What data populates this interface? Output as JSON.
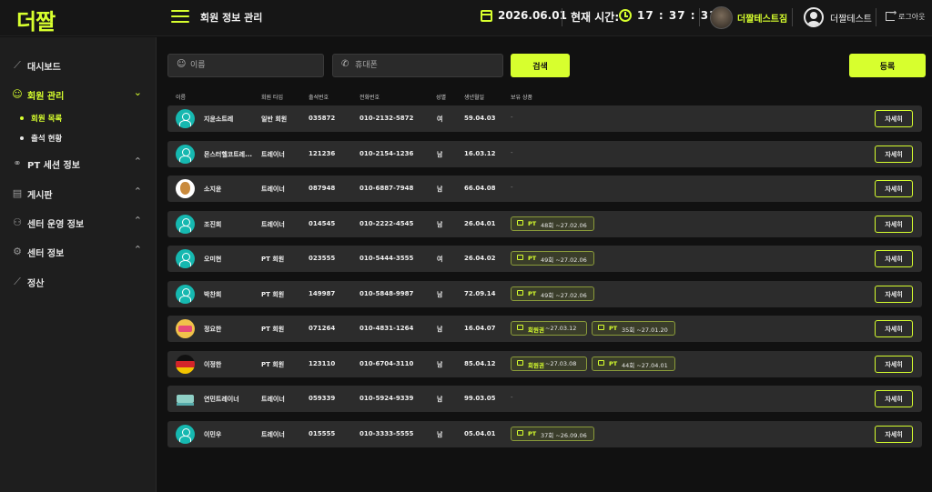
{
  "brand": {
    "logo_text": "더짤",
    "accent": "#d7ff2e"
  },
  "header": {
    "page_title": "회원 정보 관리",
    "date": "2026.06.01",
    "time_label": "현재 시간:",
    "time": "17 : 37 : 31",
    "gym_name": "더짤테스트짐",
    "user_name": "더짤테스트",
    "logout_label": "로그아웃"
  },
  "sidebar": {
    "items": [
      {
        "label": "대시보드",
        "icon": "chart-icon",
        "expandable": false
      },
      {
        "label": "회원 관리",
        "icon": "user-icon",
        "expandable": true,
        "expanded": true,
        "active": true
      },
      {
        "label": "PT 세션 정보",
        "icon": "link-icon",
        "expandable": true
      },
      {
        "label": "게시판",
        "icon": "document-icon",
        "expandable": true
      },
      {
        "label": "센터 운영 정보",
        "icon": "people-icon",
        "expandable": true
      },
      {
        "label": "센터 정보",
        "icon": "gear-icon",
        "expandable": true
      },
      {
        "label": "정산",
        "icon": "chart-icon",
        "expandable": false
      }
    ],
    "sub_items": [
      {
        "label": "회원 목록",
        "active": true
      },
      {
        "label": "출석 현황",
        "active": false
      }
    ]
  },
  "search": {
    "name_placeholder": "이름",
    "phone_placeholder": "휴대폰",
    "search_button": "검색",
    "register_button": "등록"
  },
  "table": {
    "columns": [
      "이름",
      "회원 타입",
      "출석번호",
      "전화번호",
      "성별",
      "생년월일",
      "보유 상품"
    ],
    "detail_label": "자세히",
    "rows": [
      {
        "avatar": "default",
        "name": "지윤소트레",
        "type": "일반 회원",
        "attend": "035872",
        "phone": "010-2132-5872",
        "gender": "여",
        "birth": "59.04.03",
        "products": []
      },
      {
        "avatar": "default",
        "name": "몬스터헬코트레...",
        "type": "트레이너",
        "attend": "121236",
        "phone": "010-2154-1236",
        "gender": "남",
        "birth": "16.03.12",
        "products": []
      },
      {
        "avatar": "dog",
        "name": "소지윤",
        "type": "트레이너",
        "attend": "087948",
        "phone": "010-6887-7948",
        "gender": "남",
        "birth": "66.04.08",
        "products": []
      },
      {
        "avatar": "default",
        "name": "조진희",
        "type": "트레이너",
        "attend": "014545",
        "phone": "010-2222-4545",
        "gender": "남",
        "birth": "26.04.01",
        "products": [
          {
            "name": "PT",
            "detail": "48회 ~27.02.06"
          }
        ]
      },
      {
        "avatar": "default",
        "name": "오미현",
        "type": "PT 회원",
        "attend": "023555",
        "phone": "010-5444-3555",
        "gender": "여",
        "birth": "26.04.02",
        "products": [
          {
            "name": "PT",
            "detail": "49회 ~27.02.06"
          }
        ]
      },
      {
        "avatar": "default",
        "name": "박찬희",
        "type": "PT 회원",
        "attend": "149987",
        "phone": "010-5848-9987",
        "gender": "남",
        "birth": "72.09.14",
        "products": [
          {
            "name": "PT",
            "detail": "49회 ~27.02.06"
          }
        ]
      },
      {
        "avatar": "badge",
        "name": "정요한",
        "type": "PT 회원",
        "attend": "071264",
        "phone": "010-4831-1264",
        "gender": "남",
        "birth": "16.04.07",
        "products": [
          {
            "name": "회원권",
            "detail": "~27.03.12"
          },
          {
            "name": "PT",
            "detail": "35회 ~27.01.20"
          }
        ]
      },
      {
        "avatar": "germany",
        "name": "이정한",
        "type": "PT 회원",
        "attend": "123110",
        "phone": "010-6704-3110",
        "gender": "남",
        "birth": "85.04.12",
        "products": [
          {
            "name": "회원권",
            "detail": "~27.03.08"
          },
          {
            "name": "PT",
            "detail": "44회 ~27.04.01"
          }
        ]
      },
      {
        "avatar": "ship",
        "name": "연민트레이너",
        "type": "트레이너",
        "attend": "059339",
        "phone": "010-5924-9339",
        "gender": "남",
        "birth": "99.03.05",
        "products": []
      },
      {
        "avatar": "default",
        "name": "이민우",
        "type": "트레이너",
        "attend": "015555",
        "phone": "010-3333-5555",
        "gender": "남",
        "birth": "05.04.01",
        "products": [
          {
            "name": "PT",
            "detail": "37회 ~26.09.06"
          }
        ]
      }
    ]
  }
}
